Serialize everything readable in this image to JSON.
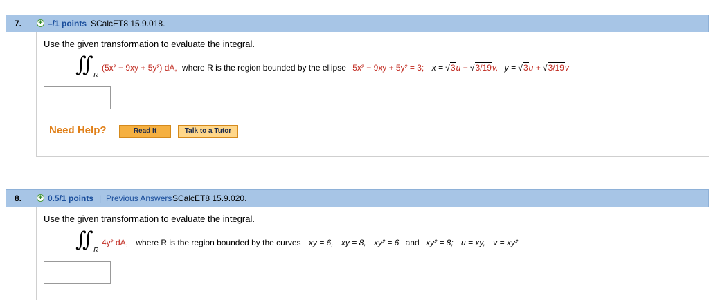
{
  "q7": {
    "number": "7.",
    "points": "–/1 points",
    "source": "SCalcET8 15.9.018.",
    "prompt": "Use the given transformation to evaluate the integral.",
    "integrand": "(5x² − 9xy + 5y²) dA,",
    "region_text": "where R is the region bounded by the ellipse",
    "ellipse": "5x² − 9xy + 5y² = 3;",
    "x_eq": "x =",
    "x_t1": "3",
    "x_u": "u −",
    "x_t2": "3/19",
    "x_v": "v,",
    "y_eq": "y =",
    "y_t1": "3",
    "y_u": "u +",
    "y_t2": "3/19",
    "y_v": "v",
    "sub": "R",
    "need_help": "Need Help?",
    "read_it": "Read It",
    "talk_tutor": "Talk to a Tutor"
  },
  "q8": {
    "number": "8.",
    "points": "0.5/1 points",
    "separator": "|",
    "previous_answers": "Previous Answers",
    "source": "SCalcET8 15.9.020.",
    "prompt": "Use the given transformation to evaluate the integral.",
    "integrand": "4y² dA,",
    "region_text": "where R is the region bounded by the curves",
    "c1": "xy = 6,",
    "c2": "xy = 8,",
    "c3": "xy² = 6",
    "and": "and",
    "c4": "xy² = 8;",
    "u_eq": "u = xy,",
    "v_eq": "v = xy²",
    "sub": "R"
  },
  "colors": {
    "header_bg": "#a7c5e6",
    "link_blue": "#1a4e9c",
    "value_red": "#c0281e",
    "help_orange": "#e0801a"
  }
}
